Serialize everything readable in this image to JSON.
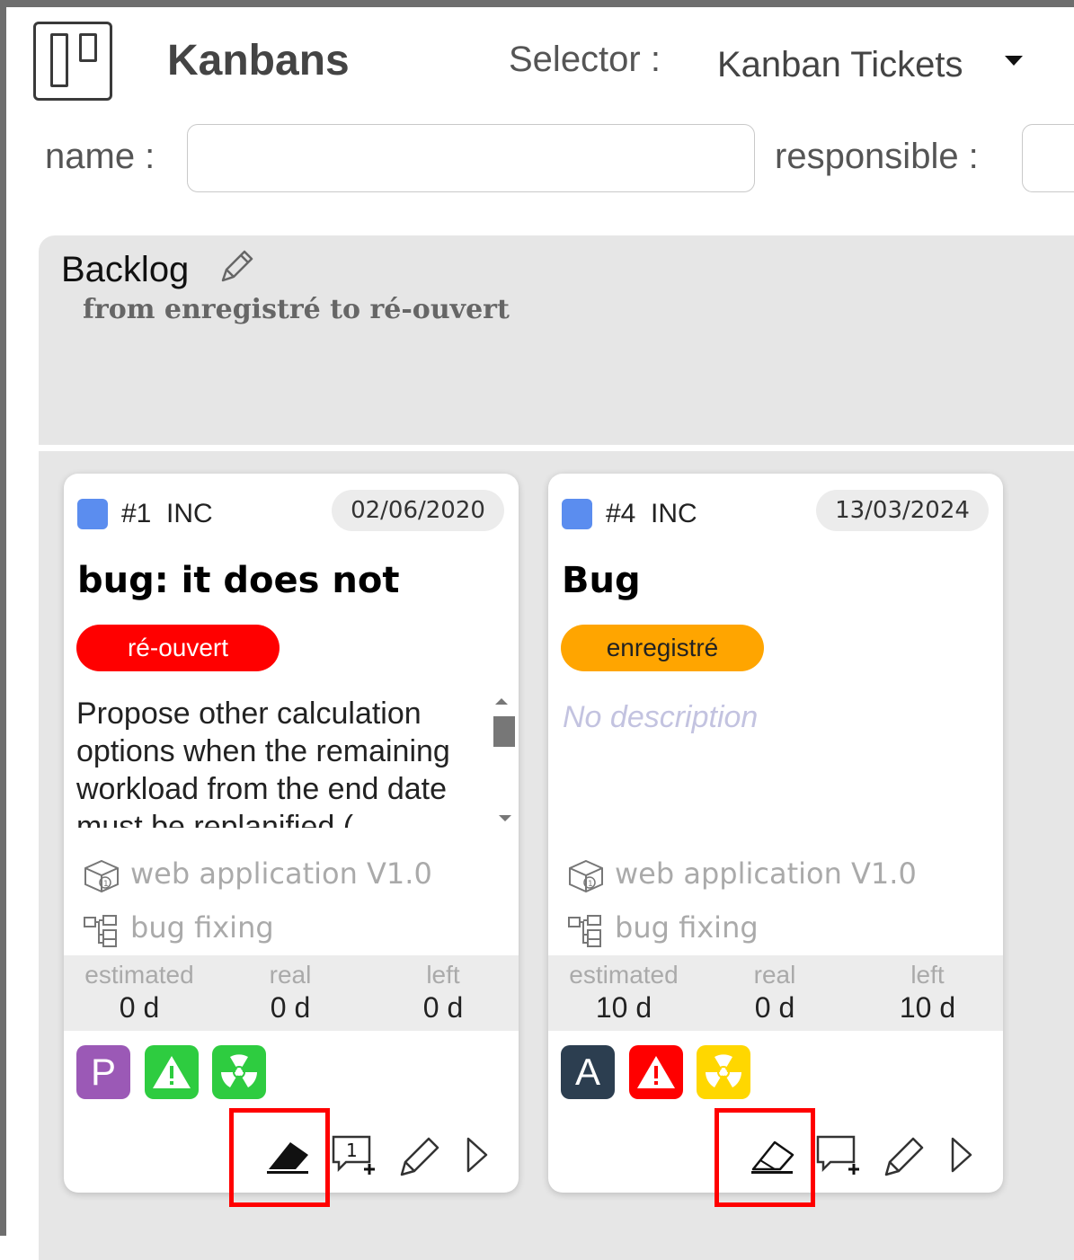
{
  "header": {
    "title": "Kanbans",
    "selector_label": "Selector :",
    "selector_value": "Kanban Tickets"
  },
  "filters": {
    "name_label": "name :",
    "name_value": "",
    "responsible_label": "responsible :"
  },
  "column": {
    "title": "Backlog",
    "subtitle": "from enregistré to ré-ouvert"
  },
  "cards": [
    {
      "id": "#1",
      "type": "INC",
      "type_color": "#5b8def",
      "date": "02/06/2020",
      "title": "bug: it does not",
      "status": "ré-ouvert",
      "status_color": "#ff0000",
      "description": "Propose other calculation options when the remaining workload from the end date must be replanified (",
      "version": "web application V1.0",
      "activity": "bug fixing",
      "work": {
        "estimated_label": "estimated",
        "estimated": "0 d",
        "real_label": "real",
        "real": "0 d",
        "left_label": "left",
        "left": "0 d"
      },
      "badges": [
        {
          "letter": "P",
          "color": "#9b59b6"
        },
        {
          "icon": "warning-icon",
          "color": "#2ecc40"
        },
        {
          "icon": "radiation-icon",
          "color": "#2ecc40"
        }
      ],
      "comment_count": "1"
    },
    {
      "id": "#4",
      "type": "INC",
      "type_color": "#5b8def",
      "date": "13/03/2024",
      "title": "Bug",
      "status": "enregistré",
      "status_color": "#ffa500",
      "description_placeholder": "No description",
      "version": "web application V1.0",
      "activity": "bug fixing",
      "work": {
        "estimated_label": "estimated",
        "estimated": "10 d",
        "real_label": "real",
        "real": "0 d",
        "left_label": "left",
        "left": "10 d"
      },
      "badges": [
        {
          "letter": "A",
          "color": "#2c3e50"
        },
        {
          "icon": "warning-icon",
          "color": "#ff0000"
        },
        {
          "icon": "radiation-icon",
          "color": "#ffd700"
        }
      ]
    }
  ],
  "highlight_color": "#ff0000"
}
